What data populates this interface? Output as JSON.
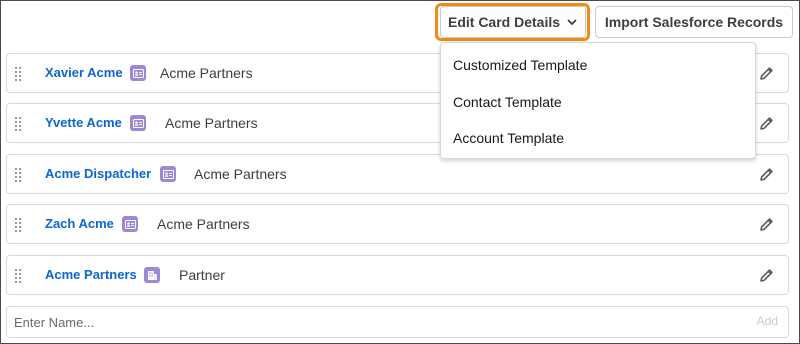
{
  "toolbar": {
    "edit_card_label": "Edit Card Details",
    "import_label": "Import Salesforce Records"
  },
  "dropdown": {
    "items": [
      {
        "label": "Customized Template"
      },
      {
        "label": "Contact Template"
      },
      {
        "label": "Account Template"
      }
    ]
  },
  "rows": [
    {
      "name": "Xavier Acme",
      "badge": "contact-card-icon",
      "org": "Acme Partners"
    },
    {
      "name": "Yvette Acme",
      "badge": "contact-card-icon",
      "org": "Acme Partners"
    },
    {
      "name": "Acme Dispatcher",
      "badge": "contact-card-icon",
      "org": "Acme Partners"
    },
    {
      "name": "Zach Acme",
      "badge": "contact-card-icon",
      "org": "Acme Partners"
    },
    {
      "name": "Acme Partners",
      "badge": "account-building-icon",
      "org": "Partner"
    }
  ],
  "new_entry": {
    "placeholder": "Enter Name...",
    "add_label": "Add"
  },
  "colors": {
    "link": "#0b66d2",
    "badge": "#9b89d5",
    "focus_ring": "#f28a18",
    "border": "#d8d8d8"
  }
}
